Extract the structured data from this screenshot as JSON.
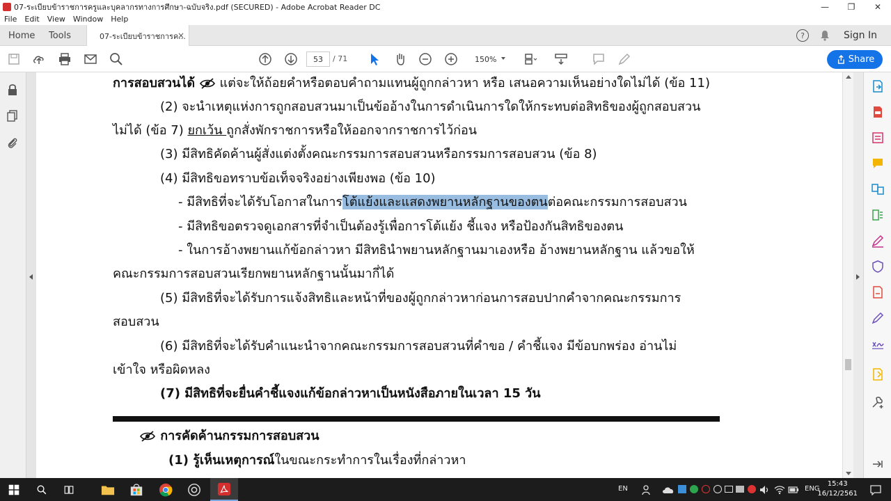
{
  "window": {
    "title": "07-ระเบียบข้าราชการครูและบุคลากรทางการศึกษา-ฉบับจริง.pdf (SECURED) - Adobe Acrobat Reader DC",
    "minimize": "—",
    "maximize": "❐",
    "close": "✕"
  },
  "menu": [
    "File",
    "Edit",
    "View",
    "Window",
    "Help"
  ],
  "tabs": {
    "home": "Home",
    "tools": "Tools",
    "document": "07-ระเบียบข้าราชการค...",
    "close": "×",
    "help": "?",
    "signin": "Sign In"
  },
  "toolbar": {
    "page_current": "53",
    "page_total": "/ 71",
    "zoom": "150%",
    "share": "Share"
  },
  "document": {
    "line1": "การสอบสวนได้",
    "line1_rest": " แต่จะให้ถ้อยคำหรือตอบคำถามแทนผู้ถูกกล่าวหา หรือ เสนอความเห็นอย่างใดไม่ได้ (ข้อ 11)",
    "line2": "(2) จะนำเหตุแห่งการถูกสอบสวนมาเป็นข้ออ้างในการดำเนินการใดให้กระทบต่อสิทธิของผู้ถูกสอบสวน",
    "line3_a": "ไม่ได้ (ข้อ 7) ",
    "line3_u": "ยกเว้น ",
    "line3_b": "ถูกสั่งพักราชการหรือให้ออกจากราชการไว้ก่อน",
    "line4": "(3) มีสิทธิคัดค้านผู้สั่งแต่งตั้งคณะกรรมการสอบสวนหรือกรรมการสอบสวน (ข้อ 8)",
    "line5": "(4) มีสิทธิขอทราบข้อเท็จจริงอย่างเพียงพอ (ข้อ 10)",
    "line6_a": "- มีสิทธิที่จะได้รับโอกาสในการ",
    "line6_hl": "โต้แย้งและแสดงพยานหลักฐานของตน",
    "line6_b": "ต่อคณะกรรมการสอบสวน",
    "line7": "- มีสิทธิขอตรวจดูเอกสารที่จำเป็นต้องรู้เพื่อการโต้แย้ง ชี้แจง หรือป้องกันสิทธิของตน",
    "line8": "- ในการอ้างพยานแก้ข้อกล่าวหา มีสิทธินำพยานหลักฐานมาเองหรือ อ้างพยานหลักฐาน แล้วขอให้",
    "line9": "คณะกรรมการสอบสวนเรียกพยานหลักฐานนั้นมากี่ได้",
    "line10": "(5) มีสิทธิที่จะได้รับการแจ้งสิทธิและหน้าที่ของผู้ถูกกล่าวหาก่อนการสอบปากคำจากคณะกรรมการ",
    "line11": "สอบสวน",
    "line12": "(6) มีสิทธิที่จะได้รับคำแนะนำจากคณะกรรมการสอบสวนที่คำขอ / คำชี้แจง มีข้อบกพร่อง อ่านไม่",
    "line13": "เข้าใจ หรือผิดหลง",
    "line14": "(7) มีสิทธิที่จะยื่นคำชี้แจงแก้ข้อกล่าวหาเป็นหนังสือภายในเวลา 15 วัน",
    "line15": "การคัดค้านกรรมการสอบสวน",
    "line16_b": "(1) รู้เห็นเหตุการณ์",
    "line16_rest": "ในขณะกระทำการในเรื่องที่กล่าวหา"
  },
  "taskbar": {
    "lang1": "EN",
    "lang2": "ENG",
    "time": "15:43",
    "date": "16/12/2561"
  },
  "colors": {
    "highlight": "#99bde0",
    "accent": "#1473e6"
  }
}
